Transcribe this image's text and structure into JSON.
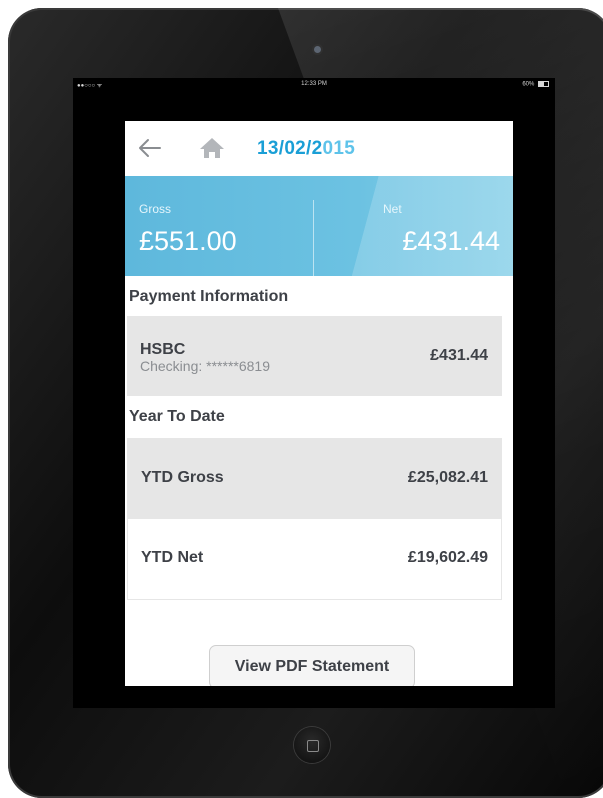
{
  "status_bar": {
    "carrier": "●●○○○ ᯤ",
    "time": "12:33 PM",
    "battery": "60%"
  },
  "header": {
    "date_main": "13/02/2",
    "date_accent": "015"
  },
  "summary": {
    "gross_label": "Gross",
    "gross_value": "£551.00",
    "net_label": "Net",
    "net_value": "£431.44"
  },
  "payment_section": {
    "title": "Payment Information",
    "bank": "HSBC",
    "account": "Checking: ******6819",
    "amount": "£431.44"
  },
  "ytd_section": {
    "title": "Year To Date",
    "rows": [
      {
        "label": "YTD Gross",
        "value": "£25,082.41"
      },
      {
        "label": "YTD Net",
        "value": "£19,602.49"
      }
    ]
  },
  "actions": {
    "pdf_label": "View PDF Statement"
  },
  "colors": {
    "accent": "#1a9fd6",
    "summary_bg": "#6cc2e2",
    "card_bg": "#e6e6e6",
    "text": "#3e4147"
  },
  "icons": {
    "back": "back-arrow-icon",
    "home": "home-icon"
  }
}
